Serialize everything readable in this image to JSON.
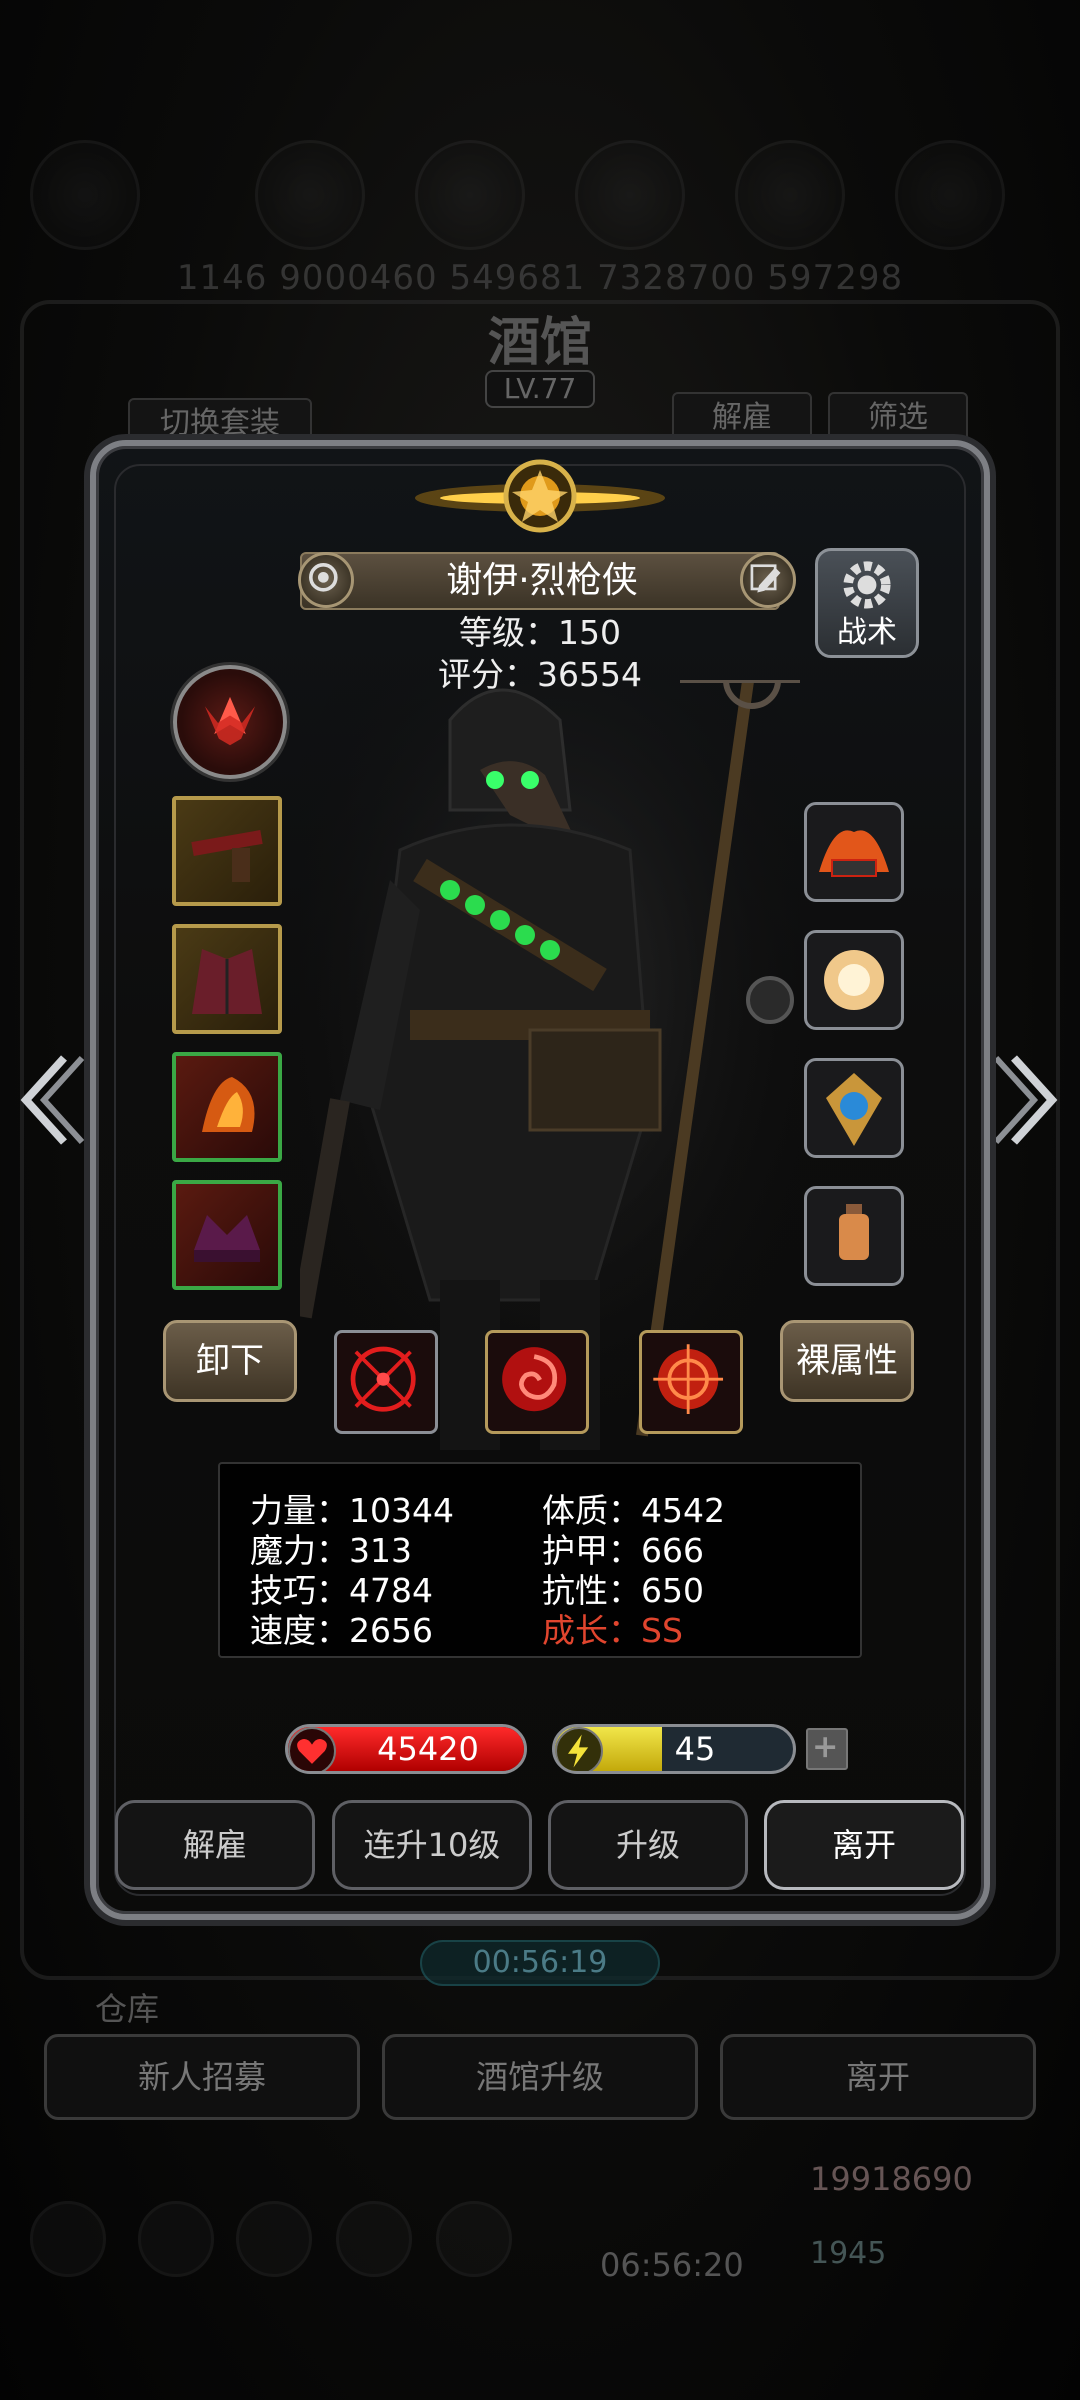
{
  "background": {
    "stats_line": "1146  9000460  549681  7328700  597298",
    "title": "酒馆",
    "level": "LV.77",
    "switch_outfit": "切换套装",
    "dismiss": "解雇",
    "filter": "筛选",
    "timer": "00:56:19",
    "warehouse": "仓库",
    "recruit": "新人招募",
    "upgrade_tavern": "酒馆升级",
    "leave": "离开",
    "gold": "19918690",
    "gems": "1945",
    "clock": "06:56:20"
  },
  "hero": {
    "name": "谢伊·烈枪侠",
    "level_line": "等级：150",
    "score_line": "评分：36554",
    "tactics_label": "战术"
  },
  "actions": {
    "unequip": "卸下",
    "naked_attributes": "裸属性"
  },
  "stats": {
    "strength": "力量：10344",
    "magic": "魔力：313",
    "skill": "技巧：4784",
    "speed": "速度：2656",
    "constitution": "体质：4542",
    "armor": "护甲：666",
    "resistance": "抗性：650",
    "growth": "成长：SS"
  },
  "bars": {
    "hp_value": "45420",
    "hp_fill": 1.0,
    "energy_value": "45",
    "energy_fill": 0.45
  },
  "buttons": {
    "dismiss": "解雇",
    "level_up_10": "连升10级",
    "level_up": "升级",
    "leave": "离开"
  },
  "colors": {
    "growth": "#e0452e",
    "hp": "#d40f0f",
    "energy": "#e3d22b"
  },
  "icons": [
    "settings-gear-icon",
    "edit-pencil-icon",
    "badge-icon",
    "heart-icon",
    "lightning-icon",
    "plus-icon",
    "arrow-left-icon",
    "arrow-right-icon"
  ]
}
